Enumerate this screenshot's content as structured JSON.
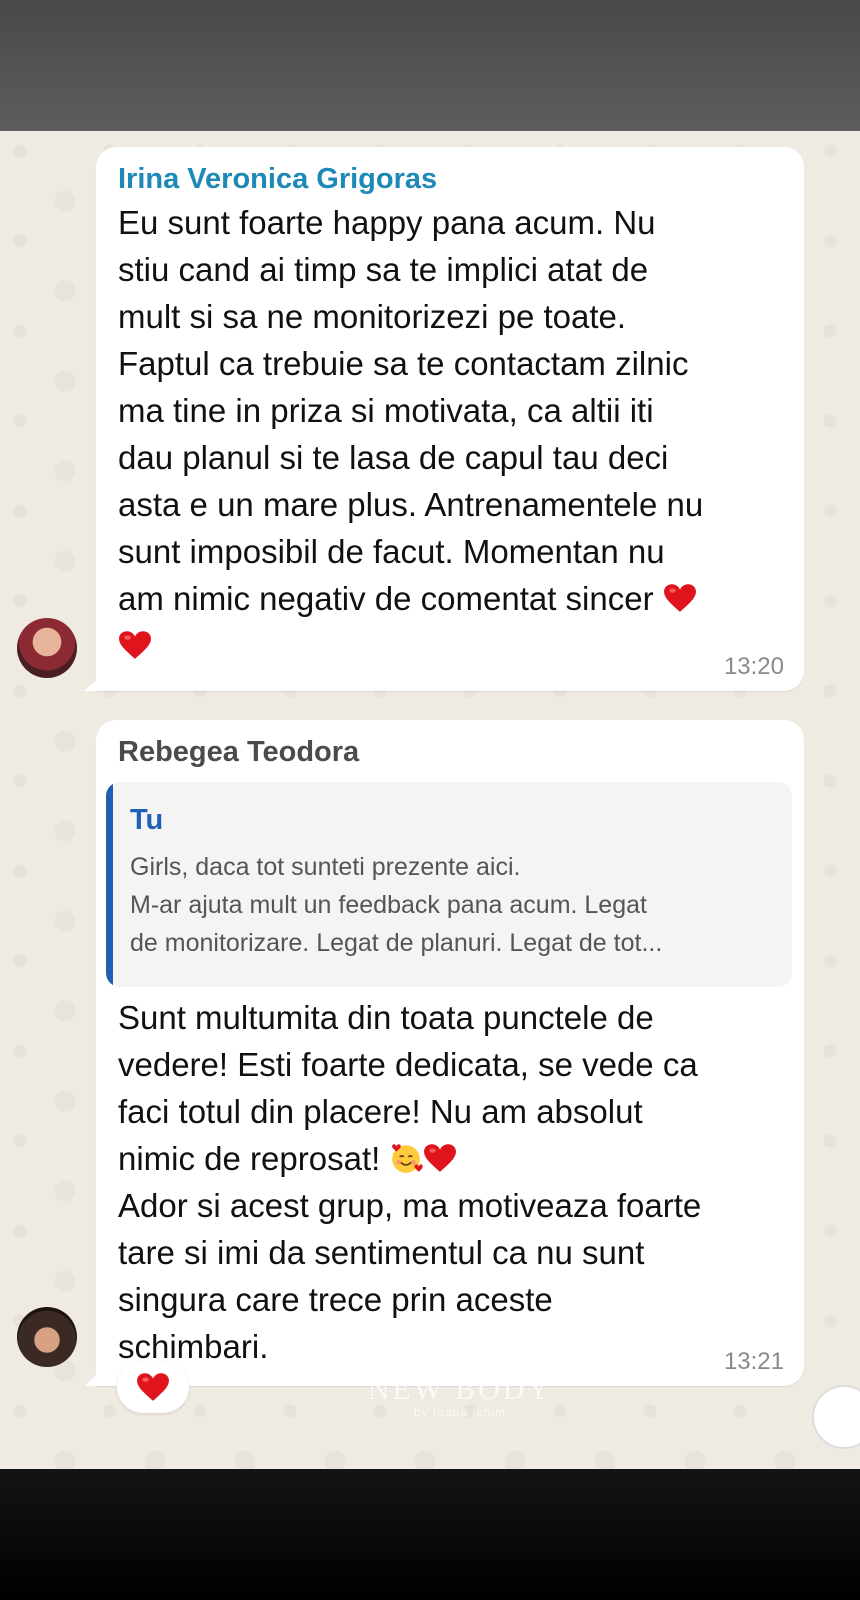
{
  "messages": [
    {
      "sender": "Irina Veronica Grigoras",
      "text": "Eu sunt foarte happy pana acum. Nu\nstiu cand ai timp sa te implici atat de\nmult si sa ne monitorizezi pe toate.\nFaptul ca trebuie sa te contactam zilnic\nma tine in priza si motivata, ca altii iti\ndau planul si te lasa de capul tau deci\nasta e un mare plus. Antrenamentele nu\nsunt imposibil de facut. Momentan nu\nam nimic negativ de comentat sincer",
      "emoji": [
        "red-heart",
        "red-heart"
      ],
      "time": "13:20"
    },
    {
      "sender": "Rebegea Teodora",
      "quote": {
        "author": "Tu",
        "text": "Girls, daca tot sunteti prezente aici.\nM-ar ajuta mult un feedback pana acum. Legat\nde monitorizare. Legat de planuri. Legat de tot..."
      },
      "text_part1": "Sunt multumita din toata punctele de\nvedere! Esti foarte dedicata, se vede ca\nfaci totul din placere! Nu am absolut\nnimic de reprosat!",
      "emoji": [
        "smiling-face-with-hearts",
        "red-heart"
      ],
      "text_part2": "Ador si acest grup, ma motiveaza foarte\ntare si imi da sentimentul ca nu sunt\nsingura care trece prin aceste\nschimbari.",
      "time": "13:21",
      "reaction": "red-heart"
    }
  ],
  "watermark": {
    "logo": "NEW BODY",
    "sub": "by Ioana Ichim"
  },
  "colors": {
    "sender1": "#1d89b7",
    "quote_accent": "#1f5fb4",
    "chat_background": "#efeae2"
  }
}
